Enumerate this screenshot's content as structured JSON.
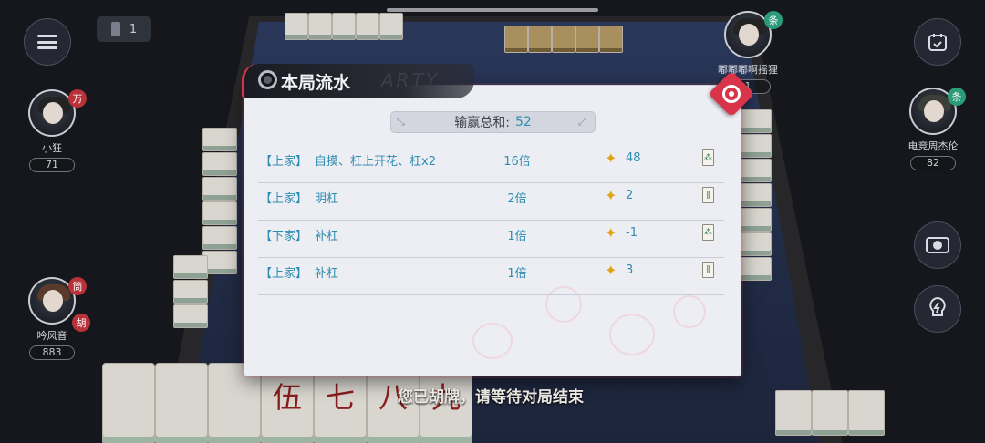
{
  "top_bar": {
    "wall_count": "1"
  },
  "players": [
    {
      "id": "left",
      "name": "小狂",
      "score": "71",
      "badge": "万"
    },
    {
      "id": "bottom-left",
      "name": "吟风音",
      "score": "883",
      "badge": "筒",
      "badge2": "胡"
    },
    {
      "id": "top-right",
      "name": "嘟嘟嘟啊摇狸",
      "score": "1",
      "badge": "条"
    },
    {
      "id": "right",
      "name": "电竞周杰伦",
      "score": "82",
      "badge": "条"
    }
  ],
  "panel": {
    "title": "本局流水",
    "total_label": "输赢总和:",
    "total_value": "52",
    "rows": [
      {
        "player": "【上家】",
        "desc": "自摸、杠上开花、杠x2",
        "multiplier": "16倍",
        "amount": "48",
        "tile_glyph": "⁂"
      },
      {
        "player": "【上家】",
        "desc": "明杠",
        "multiplier": "2倍",
        "amount": "2",
        "tile_glyph": "‖"
      },
      {
        "player": "【下家】",
        "desc": "补杠",
        "multiplier": "1倍",
        "amount": "-1",
        "tile_glyph": "⁂"
      },
      {
        "player": "【上家】",
        "desc": "补杠",
        "multiplier": "1倍",
        "amount": "3",
        "tile_glyph": "‖"
      }
    ]
  },
  "status_message": "您已胡牌，请等待对局结束",
  "hand_tiles": [
    "",
    "",
    "",
    "伍",
    "七",
    "八",
    "九"
  ],
  "icons": {
    "menu": "menu-icon",
    "calendar": "calendar-icon",
    "exchange": "money-exchange-icon",
    "hint": "lightning-bulb-icon",
    "coin": "coin-icon",
    "close": "close-icon"
  },
  "colors": {
    "accent_red": "#d8344a",
    "text_blue": "#2d8db0",
    "coin_gold": "#e0a517"
  }
}
